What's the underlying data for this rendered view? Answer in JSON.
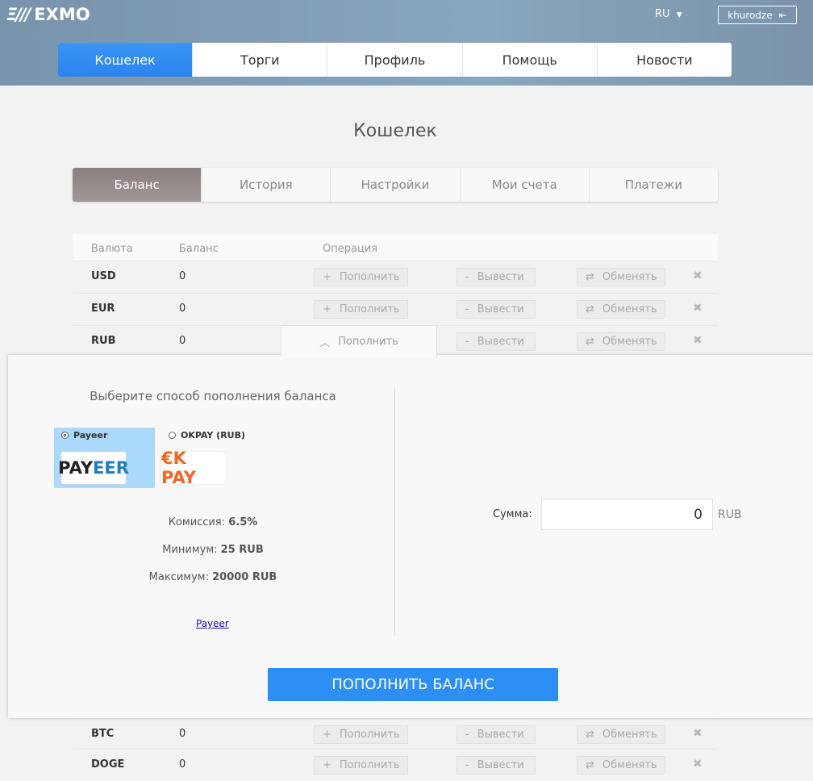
{
  "header": {
    "logo": "EXMO",
    "logo_mark": "Ξ/// ",
    "lang": "RU",
    "user": "khurodze"
  },
  "nav": [
    "Кошелек",
    "Торги",
    "Профиль",
    "Помощь",
    "Новости"
  ],
  "title": "Кошелек",
  "tabs": [
    "Баланс",
    "История",
    "Настройки",
    "Мои счета",
    "Платежи"
  ],
  "table": {
    "headers": [
      "Валюта",
      "Баланс",
      "Операция"
    ],
    "actions": {
      "deposit": "Пополнить",
      "withdraw": "Вывести",
      "exchange": "Обменять"
    },
    "rows": [
      {
        "cur": "USD",
        "bal": "0"
      },
      {
        "cur": "EUR",
        "bal": "0"
      },
      {
        "cur": "RUB",
        "bal": "0"
      },
      {
        "cur": "BTC",
        "bal": "0"
      },
      {
        "cur": "DOGE",
        "bal": "0"
      }
    ]
  },
  "panel": {
    "title": "Выберите способ пополнения баланса",
    "methods": [
      {
        "label": "Payeer",
        "logo_a": "PAY",
        "logo_b": "EER",
        "selected": true
      },
      {
        "label": "OKPAY (RUB)",
        "logo": "€K PAY",
        "selected": false
      }
    ],
    "commission_label": "Комиссия:",
    "commission": "6.5%",
    "min_label": "Минимум:",
    "min": "25 RUB",
    "max_label": "Максимум:",
    "max": "20000 RUB",
    "link": "Payeer",
    "sum_label": "Сумма:",
    "sum_value": "0",
    "currency": "RUB",
    "submit": "ПОПОЛНИТЬ БАЛАНС"
  }
}
